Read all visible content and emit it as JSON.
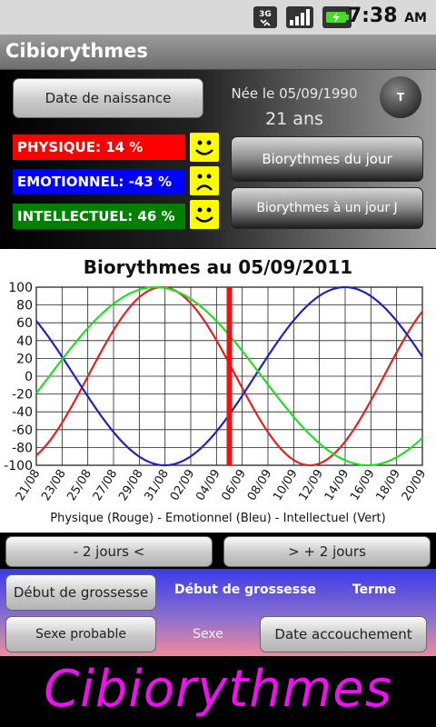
{
  "status_bar": {
    "time": "7:38",
    "ampm": "AM",
    "network": "3G"
  },
  "app": {
    "title": "Cibiorythmes"
  },
  "top": {
    "birth_button": "Date de naissance",
    "born_text": "Née le 05/09/1990",
    "age_text": "21 ans",
    "badge": "T",
    "bars": [
      {
        "label": "PHYSIQUE: 14 %",
        "value": 14,
        "color": "#ff0000",
        "mood": "happy"
      },
      {
        "label": "EMOTIONNEL: -43 %",
        "value": -43,
        "color": "#0000ff",
        "mood": "sad"
      },
      {
        "label": "INTELLECTUEL: 46 %",
        "value": 46,
        "color": "#008000",
        "mood": "happy"
      }
    ],
    "today_button": "Biorythmes du jour",
    "dayj_button": "Biorythmes à un jour J"
  },
  "chart_data": {
    "type": "line",
    "title": "Biorythmes au 05/09/2011",
    "caption": "Physique (Rouge) - Emotionnel (Bleu) - Intellectuel (Vert)",
    "ylim": [
      -100,
      100
    ],
    "yticks": [
      100,
      80,
      60,
      40,
      20,
      0,
      -20,
      -40,
      -60,
      -80,
      -100
    ],
    "x_range_days": [
      -15,
      15
    ],
    "xticks": [
      "21/08",
      "23/08",
      "25/08",
      "27/08",
      "29/08",
      "31/08",
      "02/09",
      "04/09",
      "06/09",
      "08/09",
      "10/09",
      "12/09",
      "14/09",
      "16/09",
      "18/09",
      "20/09"
    ],
    "grid": true,
    "marker_day": 0,
    "series": [
      {
        "name": "Physique",
        "color": "#dd2222",
        "period": 23,
        "value_at_marker": 14,
        "rising": false
      },
      {
        "name": "Emotionnel",
        "color": "#2222bb",
        "period": 28,
        "value_at_marker": -43,
        "rising": true
      },
      {
        "name": "Intellectuel",
        "color": "#22dd22",
        "period": 33,
        "value_at_marker": 46,
        "rising": false
      }
    ],
    "marker_color": "#ee1111"
  },
  "nav": {
    "prev": "- 2 jours <",
    "next": "> + 2 jours"
  },
  "pregnancy": {
    "start_button": "Début de grossesse",
    "start_label": "Début de grossesse",
    "term_label": "Terme",
    "sex_button": "Sexe probable",
    "sex_label": "Sexe",
    "due_button": "Date accouchement"
  },
  "banner": {
    "text": "Cibiorythmes"
  },
  "colors": {
    "title_bar": "#808080",
    "panel_blue": "#3a3ae8",
    "panel_pink": "#f08a9c",
    "banner_text": "#ee10ee"
  }
}
